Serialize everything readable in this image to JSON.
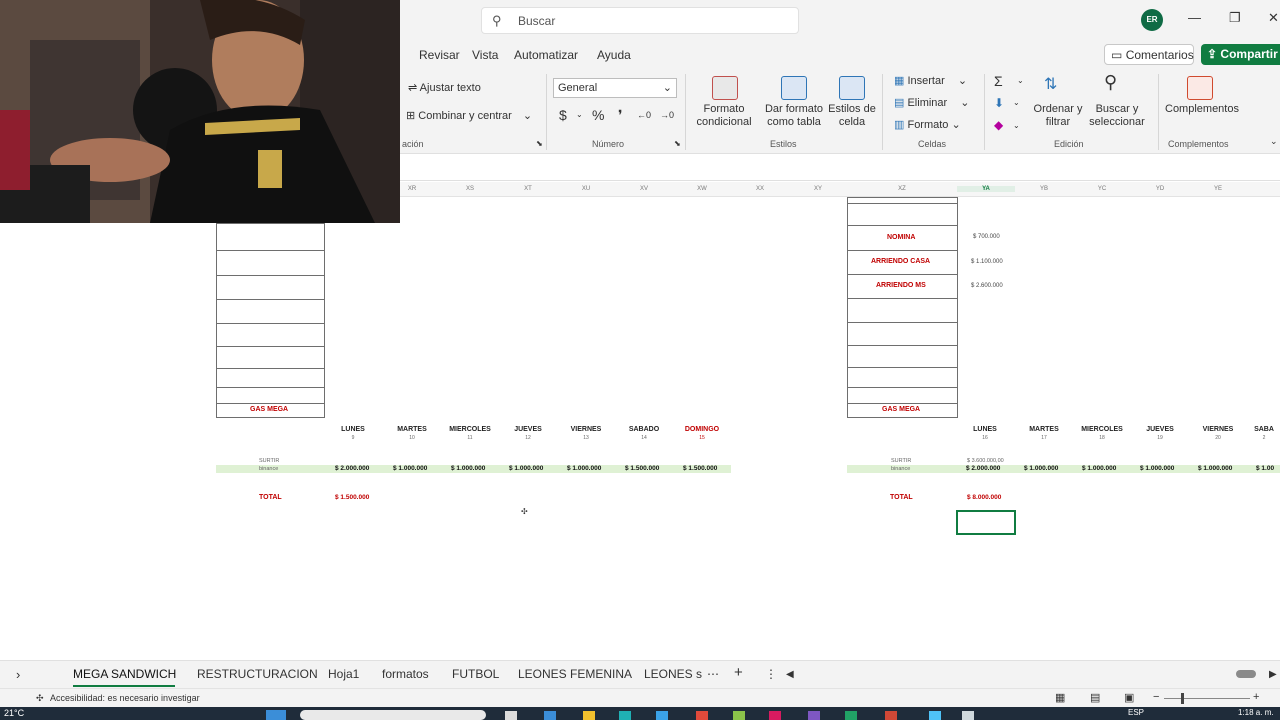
{
  "search": {
    "placeholder": "Buscar"
  },
  "user": {
    "initials": "ER"
  },
  "menu": [
    "Revisar",
    "Vista",
    "Automatizar",
    "Ayuda"
  ],
  "buttons": {
    "comments": "Comentarios",
    "share": "Compartir"
  },
  "ribbon": {
    "wrap_text": "Ajustar texto",
    "merge_center": "Combinar y centrar",
    "alignment_group": "ación",
    "number_format": "General",
    "number_group": "Número",
    "cond_format": "Formato condicional",
    "format_table": "Dar formato como tabla",
    "cell_styles": "Estilos de celda",
    "styles_group": "Estilos",
    "insert": "Insertar",
    "delete": "Eliminar",
    "format": "Formato",
    "cells_group": "Celdas",
    "sort_filter": "Ordenar y filtrar",
    "find_select": "Buscar y seleccionar",
    "editing_group": "Edición",
    "addins": "Complementos",
    "addins_group": "Complementos"
  },
  "columns": [
    "XR",
    "XS",
    "XT",
    "XU",
    "XV",
    "XW",
    "XX",
    "XY",
    "XZ",
    "YA",
    "YB",
    "YC",
    "YD",
    "YE"
  ],
  "left_block": {
    "gas_label": "GAS MEGA",
    "days": [
      "LUNES",
      "MARTES",
      "MIERCOLES",
      "JUEVES",
      "VIERNES",
      "SABADO",
      "DOMINGO"
    ],
    "day_nums": [
      "9",
      "10",
      "11",
      "12",
      "13",
      "14",
      "15"
    ],
    "surtir": "SURTIR",
    "binance": "binance",
    "amounts": [
      "$ 2.000.000",
      "$ 1.000.000",
      "$ 1.000.000",
      "$ 1.000.000",
      "$ 1.000.000",
      "$ 1.500.000",
      "$ 1.500.000"
    ],
    "total_label": "TOTAL",
    "total_value": "$ 1.500.000"
  },
  "right_block": {
    "rows": [
      {
        "label": "NOMINA",
        "value": "$ 700.000"
      },
      {
        "label": "ARRIENDO CASA",
        "value": "$ 1.100.000"
      },
      {
        "label": "ARRIENDO MS",
        "value": "$ 2.600.000"
      }
    ],
    "gas_label": "GAS MEGA",
    "days": [
      "LUNES",
      "MARTES",
      "MIERCOLES",
      "JUEVES",
      "VIERNES",
      "SABA"
    ],
    "day_nums": [
      "16",
      "17",
      "18",
      "19",
      "20",
      "2"
    ],
    "surtir": "SURTIR",
    "surtir_value": "$ 3.600.000,00",
    "binance": "binance",
    "amounts": [
      "$ 2.000.000",
      "$ 1.000.000",
      "$ 1.000.000",
      "$ 1.000.000",
      "$ 1.000.000",
      "$ 1.00"
    ],
    "total_label": "TOTAL",
    "total_value": "$ 8.000.000"
  },
  "sheet_tabs": [
    "MEGA SANDWICH",
    "RESTRUCTURACION",
    "Hoja1",
    "formatos",
    "FUTBOL",
    "LEONES FEMENINA",
    "LEONES s"
  ],
  "status": {
    "accessibility": "Accesibilidad: es necesario investigar"
  },
  "taskbar": {
    "temp": "21°C",
    "lang": "ESP",
    "time": "1:18 a. m."
  }
}
